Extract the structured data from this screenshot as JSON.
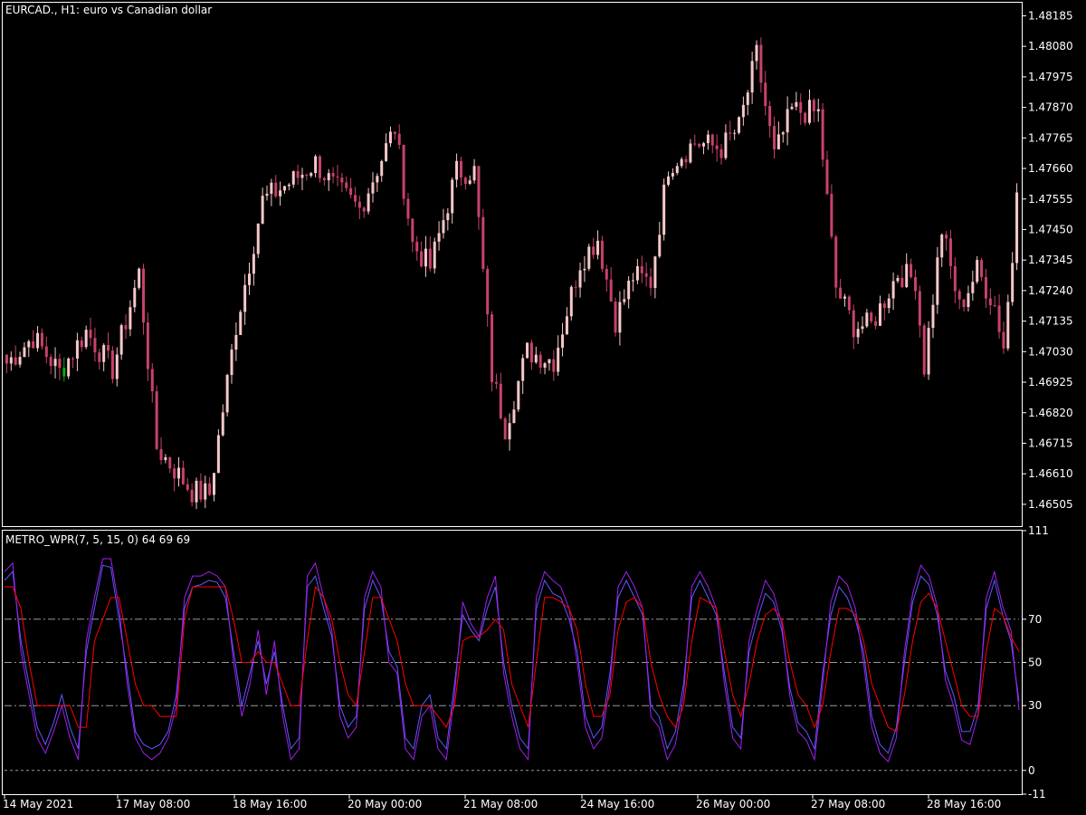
{
  "colors": {
    "background": "#000000",
    "frame": "#ffffff",
    "bull_candle": "#f7c8c8",
    "bear_candle": "#c8426a",
    "highlight_candle": "#00b400",
    "wpr_fast": "#5a5aff",
    "wpr_slow": "#a020f0",
    "signal": "#ff0000",
    "level_line": "#9a9a9a"
  },
  "chart_data": [
    {
      "type": "candlestick",
      "title": "EURCAD., H1:  euro vs Canadian dollar",
      "yticks": [
        "1.48185",
        "1.48080",
        "1.47975",
        "1.47870",
        "1.47765",
        "1.47660",
        "1.47555",
        "1.47450",
        "1.47345",
        "1.47240",
        "1.47135",
        "1.47030",
        "1.46925",
        "1.46820",
        "1.46715",
        "1.46610",
        "1.46505"
      ],
      "ylim": [
        1.4643,
        1.4823
      ],
      "grid": false,
      "n_bars": 230,
      "anchors": [
        {
          "bar": 0,
          "price": 1.4699
        },
        {
          "bar": 6,
          "price": 1.4708
        },
        {
          "bar": 12,
          "price": 1.4696
        },
        {
          "bar": 18,
          "price": 1.471
        },
        {
          "bar": 24,
          "price": 1.4697
        },
        {
          "bar": 30,
          "price": 1.473
        },
        {
          "bar": 34,
          "price": 1.467
        },
        {
          "bar": 42,
          "price": 1.4655
        },
        {
          "bar": 46,
          "price": 1.4654
        },
        {
          "bar": 52,
          "price": 1.4712
        },
        {
          "bar": 58,
          "price": 1.4755
        },
        {
          "bar": 65,
          "price": 1.4762
        },
        {
          "bar": 70,
          "price": 1.4768
        },
        {
          "bar": 74,
          "price": 1.476
        },
        {
          "bar": 80,
          "price": 1.4752
        },
        {
          "bar": 88,
          "price": 1.478
        },
        {
          "bar": 92,
          "price": 1.474
        },
        {
          "bar": 96,
          "price": 1.4732
        },
        {
          "bar": 102,
          "price": 1.4765
        },
        {
          "bar": 106,
          "price": 1.4765
        },
        {
          "bar": 110,
          "price": 1.4695
        },
        {
          "bar": 113,
          "price": 1.4677
        },
        {
          "bar": 118,
          "price": 1.4703
        },
        {
          "bar": 124,
          "price": 1.47
        },
        {
          "bar": 130,
          "price": 1.4734
        },
        {
          "bar": 134,
          "price": 1.4742
        },
        {
          "bar": 138,
          "price": 1.4714
        },
        {
          "bar": 142,
          "price": 1.4729
        },
        {
          "bar": 146,
          "price": 1.4727
        },
        {
          "bar": 150,
          "price": 1.4767
        },
        {
          "bar": 156,
          "price": 1.4775
        },
        {
          "bar": 162,
          "price": 1.4773
        },
        {
          "bar": 166,
          "price": 1.478
        },
        {
          "bar": 170,
          "price": 1.4805
        },
        {
          "bar": 174,
          "price": 1.477
        },
        {
          "bar": 178,
          "price": 1.4786
        },
        {
          "bar": 184,
          "price": 1.4785
        },
        {
          "bar": 188,
          "price": 1.4725
        },
        {
          "bar": 192,
          "price": 1.4712
        },
        {
          "bar": 196,
          "price": 1.4712
        },
        {
          "bar": 202,
          "price": 1.473
        },
        {
          "bar": 206,
          "price": 1.4728
        },
        {
          "bar": 208,
          "price": 1.4698
        },
        {
          "bar": 212,
          "price": 1.4745
        },
        {
          "bar": 216,
          "price": 1.4718
        },
        {
          "bar": 220,
          "price": 1.4731
        },
        {
          "bar": 224,
          "price": 1.4719
        },
        {
          "bar": 226,
          "price": 1.4705
        },
        {
          "bar": 228,
          "price": 1.4735
        },
        {
          "bar": 229,
          "price": 1.4762
        }
      ]
    },
    {
      "type": "line",
      "title": "METRO_WPR(7, 5, 15, 0) 64 69 69",
      "yticks": [
        "111",
        "70",
        "50",
        "30",
        "0",
        "-11"
      ],
      "ylim": [
        -11,
        111
      ],
      "levels": [
        70,
        50,
        30
      ],
      "zero_line": 0,
      "x": [
        "14 May 2021",
        "17 May 08:00",
        "18 May 16:00",
        "20 May 00:00",
        "21 May 08:00",
        "24 May 16:00",
        "26 May 00:00",
        "27 May 08:00",
        "28 May 16:00"
      ],
      "series": [
        {
          "role": "fast",
          "color": "#5a5aff",
          "values": [
            88,
            92,
            60,
            40,
            20,
            12,
            22,
            35,
            20,
            10,
            55,
            75,
            95,
            94,
            70,
            45,
            18,
            12,
            10,
            12,
            18,
            35,
            75,
            85,
            86,
            88,
            87,
            80,
            55,
            30,
            45,
            60,
            40,
            55,
            30,
            10,
            15,
            85,
            90,
            75,
            62,
            30,
            20,
            25,
            75,
            88,
            80,
            55,
            48,
            15,
            10,
            30,
            35,
            15,
            10,
            40,
            72,
            65,
            60,
            75,
            85,
            50,
            30,
            15,
            10,
            75,
            88,
            82,
            80,
            70,
            55,
            25,
            15,
            20,
            45,
            80,
            88,
            80,
            72,
            30,
            25,
            10,
            18,
            40,
            80,
            88,
            80,
            72,
            45,
            20,
            15,
            55,
            70,
            82,
            78,
            65,
            38,
            22,
            18,
            10,
            45,
            72,
            85,
            80,
            70,
            55,
            25,
            12,
            8,
            20,
            50,
            78,
            90,
            86,
            72,
            46,
            35,
            18,
            18,
            30,
            75,
            88,
            72,
            60,
            32
          ]
        },
        {
          "role": "slow",
          "color": "#a020f0",
          "values": [
            92,
            96,
            55,
            35,
            15,
            8,
            18,
            30,
            15,
            5,
            60,
            80,
            98,
            98,
            75,
            40,
            15,
            8,
            5,
            8,
            15,
            30,
            80,
            90,
            90,
            92,
            90,
            85,
            50,
            25,
            40,
            65,
            35,
            60,
            25,
            5,
            10,
            90,
            96,
            80,
            65,
            25,
            15,
            20,
            80,
            92,
            85,
            50,
            45,
            10,
            5,
            25,
            30,
            10,
            5,
            35,
            78,
            68,
            62,
            80,
            90,
            45,
            25,
            10,
            5,
            80,
            92,
            88,
            85,
            75,
            50,
            20,
            10,
            15,
            40,
            85,
            92,
            85,
            75,
            25,
            20,
            5,
            12,
            35,
            85,
            92,
            85,
            75,
            40,
            15,
            10,
            60,
            75,
            88,
            82,
            68,
            34,
            18,
            14,
            5,
            40,
            78,
            90,
            86,
            75,
            50,
            20,
            8,
            4,
            15,
            55,
            82,
            95,
            90,
            76,
            42,
            30,
            14,
            12,
            26,
            80,
            92,
            76,
            65,
            28
          ]
        },
        {
          "role": "signal",
          "color": "#ff0000",
          "values": [
            85,
            85,
            75,
            50,
            30,
            30,
            30,
            30,
            30,
            20,
            20,
            60,
            70,
            80,
            80,
            60,
            40,
            30,
            30,
            25,
            25,
            25,
            70,
            85,
            85,
            85,
            85,
            85,
            70,
            50,
            50,
            55,
            50,
            50,
            40,
            30,
            30,
            60,
            85,
            80,
            70,
            50,
            35,
            30,
            55,
            80,
            80,
            70,
            60,
            40,
            30,
            30,
            30,
            25,
            20,
            30,
            60,
            62,
            62,
            65,
            70,
            65,
            40,
            30,
            20,
            50,
            80,
            80,
            78,
            75,
            65,
            40,
            25,
            25,
            35,
            65,
            78,
            80,
            75,
            50,
            35,
            25,
            20,
            30,
            60,
            80,
            78,
            75,
            55,
            35,
            25,
            40,
            60,
            72,
            75,
            70,
            50,
            35,
            30,
            20,
            30,
            55,
            75,
            75,
            72,
            60,
            40,
            30,
            20,
            18,
            35,
            60,
            78,
            82,
            75,
            60,
            45,
            30,
            25,
            25,
            55,
            75,
            72,
            62,
            55
          ]
        }
      ]
    }
  ]
}
